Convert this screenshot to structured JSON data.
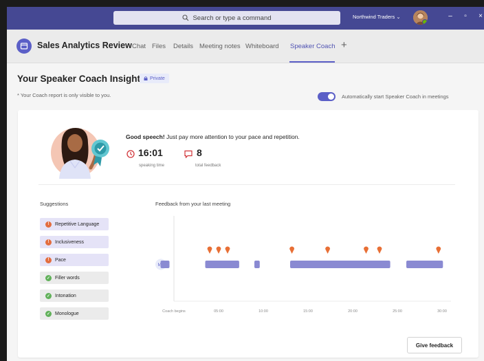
{
  "window": {
    "search_placeholder": "Search or type a command",
    "org_name": "Northwind Traders ⌄"
  },
  "channel": {
    "title": "Sales Analytics Review",
    "tabs": [
      {
        "label": "Chat",
        "active": false
      },
      {
        "label": "Files",
        "active": false
      },
      {
        "label": "Details",
        "active": false
      },
      {
        "label": "Meeting notes",
        "active": false
      },
      {
        "label": "Whiteboard",
        "active": false
      },
      {
        "label": "Speaker Coach",
        "active": true
      }
    ],
    "add_tab": "+"
  },
  "insights": {
    "title": "Your Speaker Coach Insights",
    "private_badge": "Private",
    "subtitle": "* Your Coach report is only visible to you.",
    "toggle_label": "Automatically start Speaker Coach in meetings",
    "toggle_on": true
  },
  "summary": {
    "headline_bold": "Good speech!",
    "headline_rest": " Just pay more attention to your pace and repetition.",
    "speaking_time": "16:01",
    "speaking_time_label": "speaking time",
    "total_feedback": "8",
    "total_feedback_label": "total feedback"
  },
  "suggestions": {
    "title": "Suggestions",
    "items": [
      {
        "label": "Repetitive Language",
        "status": "issue",
        "badge": "!"
      },
      {
        "label": "Inclusiveness",
        "status": "issue",
        "badge": "!"
      },
      {
        "label": "Pace",
        "status": "issue",
        "badge": "!"
      },
      {
        "label": "Filler words",
        "status": "ok",
        "badge": "✓"
      },
      {
        "label": "Intonation",
        "status": "ok",
        "badge": "✓"
      },
      {
        "label": "Monologue",
        "status": "ok",
        "badge": "✓"
      }
    ]
  },
  "feedback": {
    "title": "Feedback from your last meeting",
    "speaker_initials": "MB",
    "x_labels": [
      "Coach begins",
      "05:00",
      "10:00",
      "15:00",
      "20:00",
      "25:00",
      "30:00"
    ],
    "speaking_segments": [
      [
        -1.5,
        -0.5
      ],
      [
        3.5,
        7.3
      ],
      [
        9.0,
        9.6
      ],
      [
        13.0,
        24.2
      ],
      [
        26.0,
        30.1
      ]
    ],
    "feedback_markers": [
      4.0,
      5.0,
      6.0,
      13.2,
      17.2,
      21.5,
      23.0,
      29.6
    ],
    "accent_bar": "#8a8ad2",
    "accent_marker": "#e86f35"
  },
  "actions": {
    "give_feedback": "Give feedback"
  }
}
